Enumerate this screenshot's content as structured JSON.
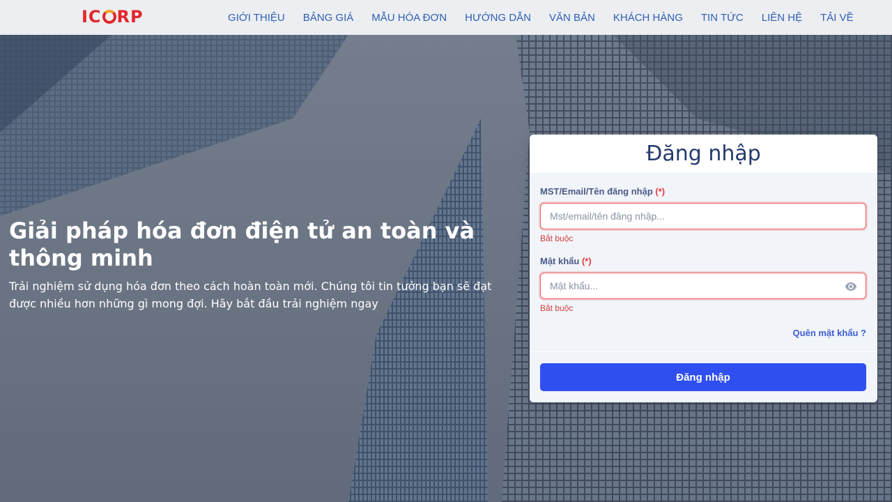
{
  "brand": {
    "logo_prefix": "IC",
    "logo_suffix": "RP",
    "color": "#e2262b"
  },
  "nav": [
    {
      "label": "GIỚI THIỆU"
    },
    {
      "label": "BẢNG GIÁ"
    },
    {
      "label": "MẪU HÓA ĐƠN"
    },
    {
      "label": "HƯỚNG DẪN"
    },
    {
      "label": "VĂN BẢN"
    },
    {
      "label": "KHÁCH HÀNG"
    },
    {
      "label": "TIN TỨC"
    },
    {
      "label": "LIÊN HỆ"
    },
    {
      "label": "TẢI VỀ"
    }
  ],
  "hero": {
    "title": "Giải pháp hóa đơn điện tử an toàn và thông minh",
    "subtitle": "Trải nghiệm sử dụng hóa đơn theo cách hoàn toàn mới. Chúng tôi tin tưởng bạn sẽ đạt được nhiều hơn những gì mong đợi. Hãy bắt đầu trải nghiệm ngay"
  },
  "login": {
    "title": "Đăng nhập",
    "username_label": "MST/Email/Tên đăng nhập",
    "username_placeholder": "Mst/email/tên đăng nhập...",
    "username_value": "",
    "username_error": "Bắt buộc",
    "password_label": "Mật khẩu",
    "password_placeholder": "Mật khẩu...",
    "password_value": "",
    "password_error": "Bắt buộc",
    "required_mark": "(*)",
    "forgot_label": "Quên mật khẩu ?",
    "submit_label": "Đăng nhập",
    "password_toggle_icon": "eye-icon"
  },
  "colors": {
    "accent": "#2f4ff0",
    "nav_text": "#2f5fb3",
    "error": "#d33c3c"
  }
}
